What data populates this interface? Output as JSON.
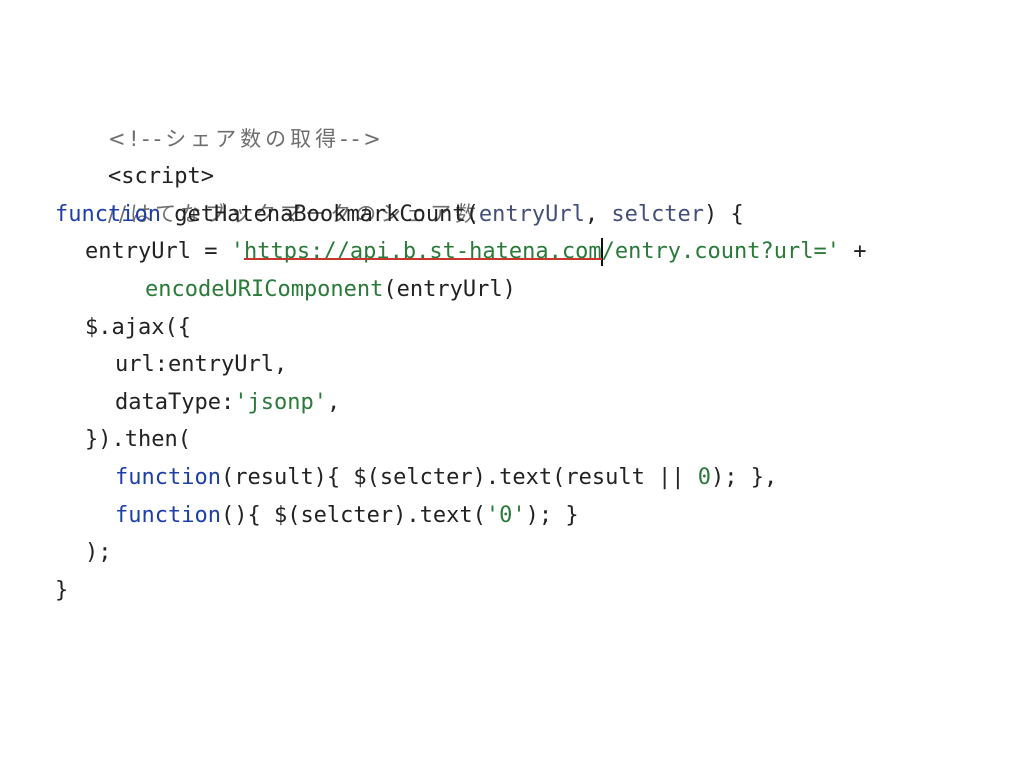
{
  "code": {
    "l1_comment": "<!--シェア数の取得-->",
    "l2_tag": "<script>",
    "l3_comment": "//はてなブックマークのシェア数",
    "l4_keyword": "function",
    "l4_fname": " getHatenaBookmarkCount(",
    "l4_param1": "entryUrl",
    "l4_comma": ", ",
    "l4_param2": "selcter",
    "l4_close": ") {",
    "l5_lhs": "entryUrl = ",
    "l5_quote_open": "'",
    "l5_url": "https://api.b.st-hatena.com",
    "l5_rest": "/entry.count?url='",
    "l5_plus": " +",
    "l6_func": "encodeURIComponent",
    "l6_arg": "(entryUrl)",
    "l7_text": "$.ajax({",
    "l8_text": "url:entryUrl,",
    "l9_key": "dataType:",
    "l9_val": "'jsonp'",
    "l9_comma": ",",
    "l10_text": "}).then(",
    "l11_kw": "function",
    "l11_mid": "(result){ $(selcter).text(result || ",
    "l11_num": "0",
    "l11_end": "); },",
    "l12_kw": "function",
    "l12_mid": "(){ $(selcter).text(",
    "l12_str": "'0'",
    "l12_end": "); }",
    "l13_text": ");",
    "l14_text": "}"
  },
  "colors": {
    "keyword": "#1f3fa8",
    "string": "#2a7a3a",
    "comment": "#6e6e6e",
    "highlight_underline": "#c8352b"
  }
}
